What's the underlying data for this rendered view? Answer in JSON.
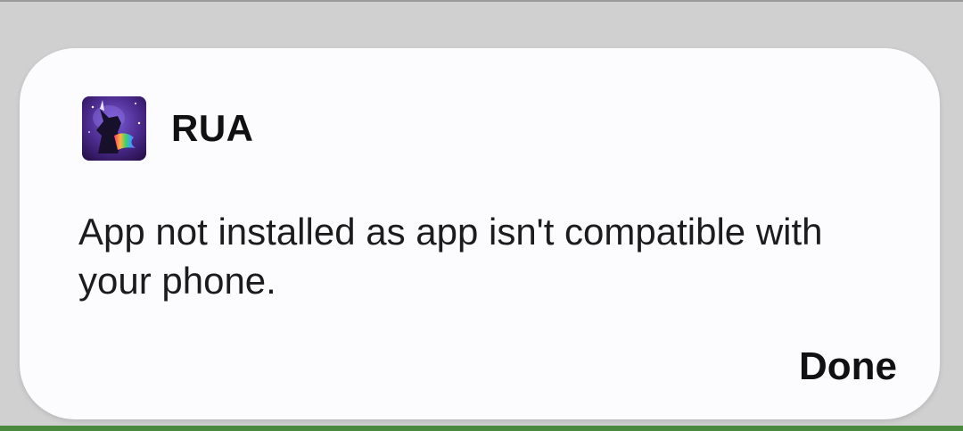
{
  "dialog": {
    "app_name": "RUA",
    "app_icon": "unicorn-app-icon",
    "message": "App not installed as app isn't compatible with your phone.",
    "done_label": "Done"
  },
  "colors": {
    "dialog_background": "#fcfbfe",
    "scrim": "#d0d0d0",
    "bottom_accent": "#4a8a3e",
    "text_primary": "#111111"
  }
}
